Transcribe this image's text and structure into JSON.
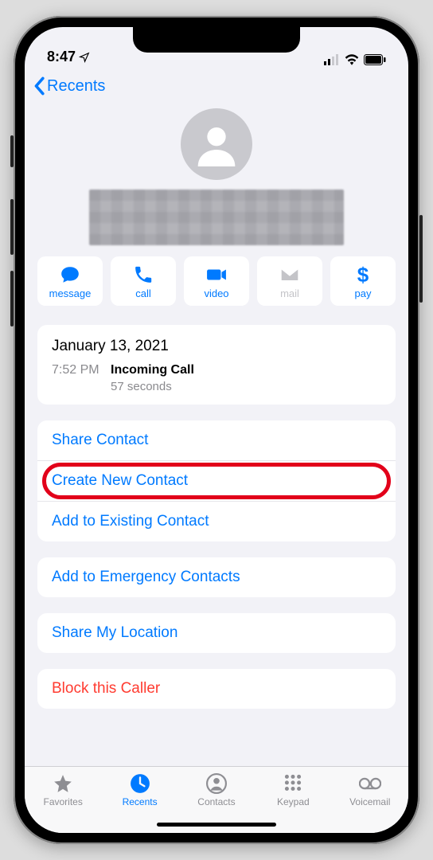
{
  "status": {
    "time": "8:47"
  },
  "nav": {
    "back_label": "Recents"
  },
  "actions": {
    "message": "message",
    "call": "call",
    "video": "video",
    "mail": "mail",
    "pay": "pay"
  },
  "call_info": {
    "date": "January 13, 2021",
    "time": "7:52 PM",
    "type": "Incoming Call",
    "duration": "57 seconds"
  },
  "options": {
    "share_contact": "Share Contact",
    "create_new": "Create New Contact",
    "add_existing": "Add to Existing Contact",
    "add_emergency": "Add to Emergency Contacts",
    "share_location": "Share My Location",
    "block": "Block this Caller"
  },
  "tabs": {
    "favorites": "Favorites",
    "recents": "Recents",
    "contacts": "Contacts",
    "keypad": "Keypad",
    "voicemail": "Voicemail"
  }
}
